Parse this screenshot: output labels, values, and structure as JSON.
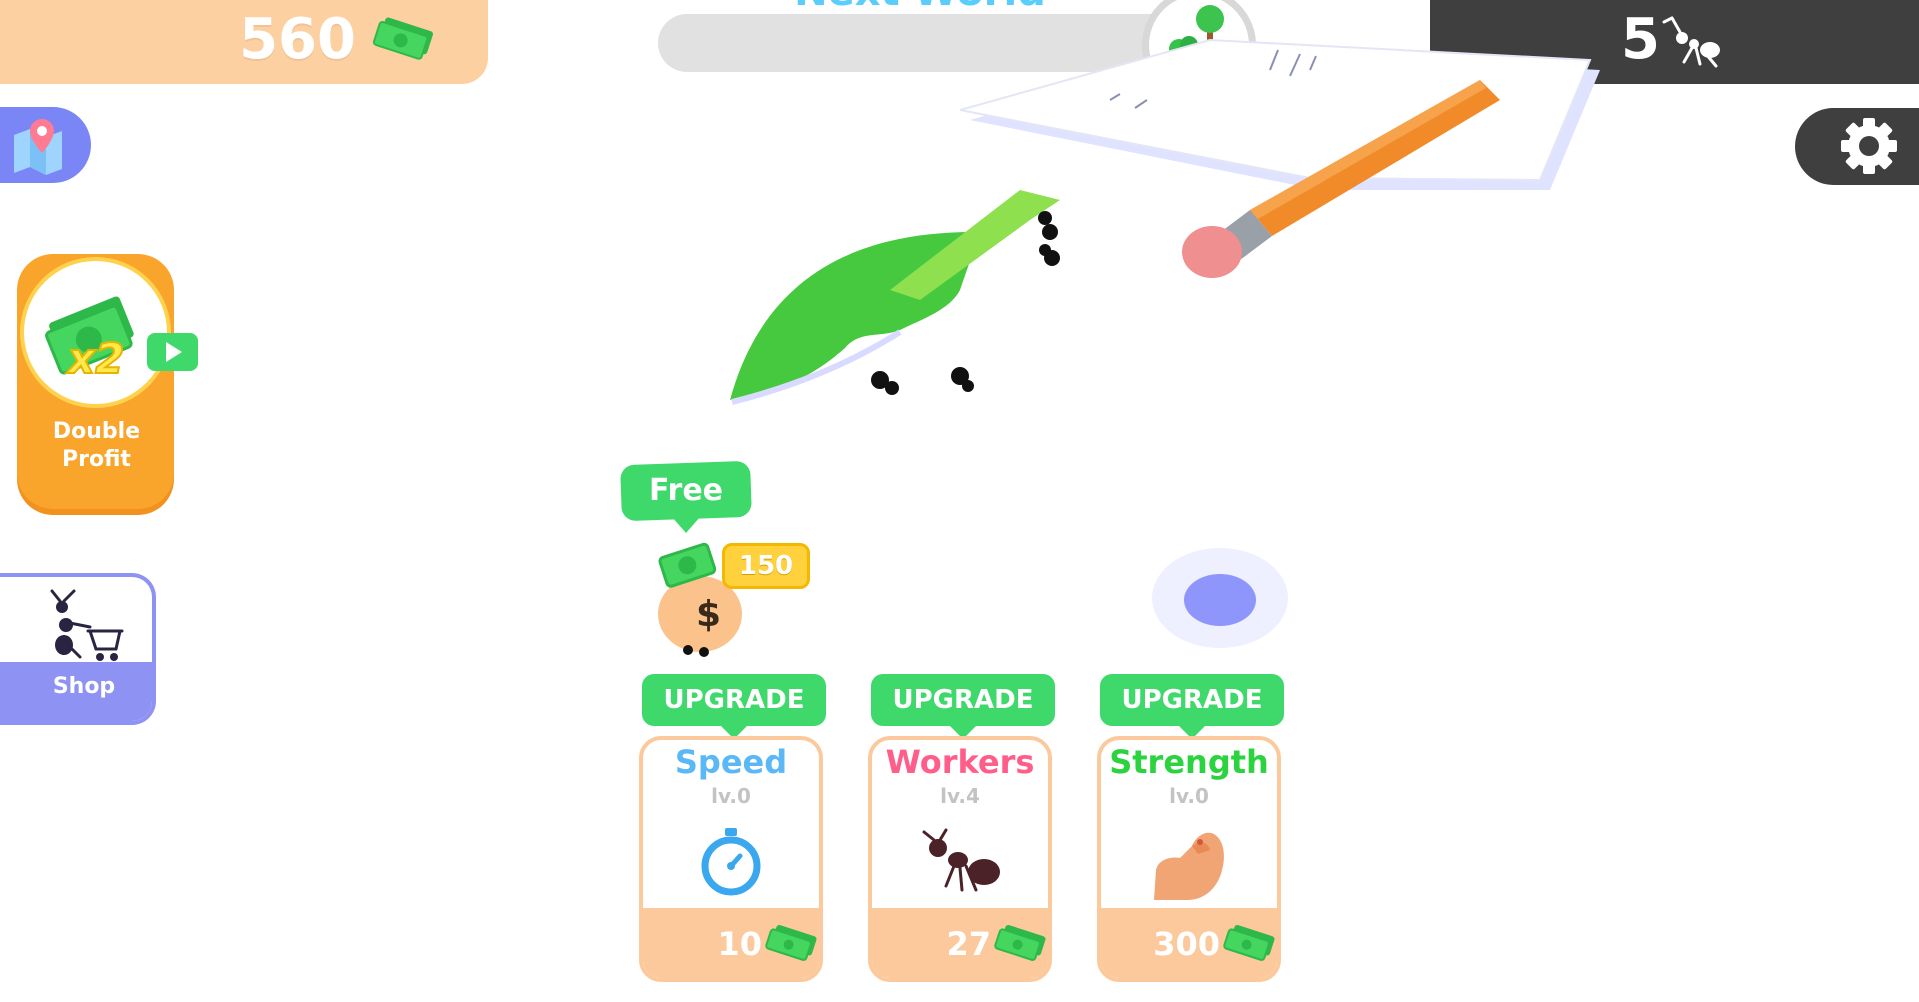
{
  "top_bar": {
    "money": "560",
    "next_world_label": "Next World",
    "next_world_progress": 0.0,
    "ant_count": "5"
  },
  "left_panel": {
    "double_profit": {
      "multiplier": "x2",
      "label": "Double Profit"
    },
    "shop_label": "Shop"
  },
  "world": {
    "free_label": "Free",
    "bag_reward": "150"
  },
  "upgrades": [
    {
      "tag": "UPGRADE",
      "title": "Speed",
      "level": "lv.0",
      "price": "10",
      "title_color": "#59b8f5",
      "icon": "stopwatch-icon"
    },
    {
      "tag": "UPGRADE",
      "title": "Workers",
      "level": "lv.4",
      "price": "27",
      "title_color": "#ff5e8a",
      "icon": "ant-icon"
    },
    {
      "tag": "UPGRADE",
      "title": "Strength",
      "level": "lv.0",
      "price": "300",
      "title_color": "#2bd33f",
      "icon": "flexed-arm-icon"
    }
  ],
  "colors": {
    "accent_green": "#3fd86b",
    "money_bar": "#fdd0a1",
    "dark_bar": "#3f3f3f",
    "map_blue": "#7b86f6"
  }
}
